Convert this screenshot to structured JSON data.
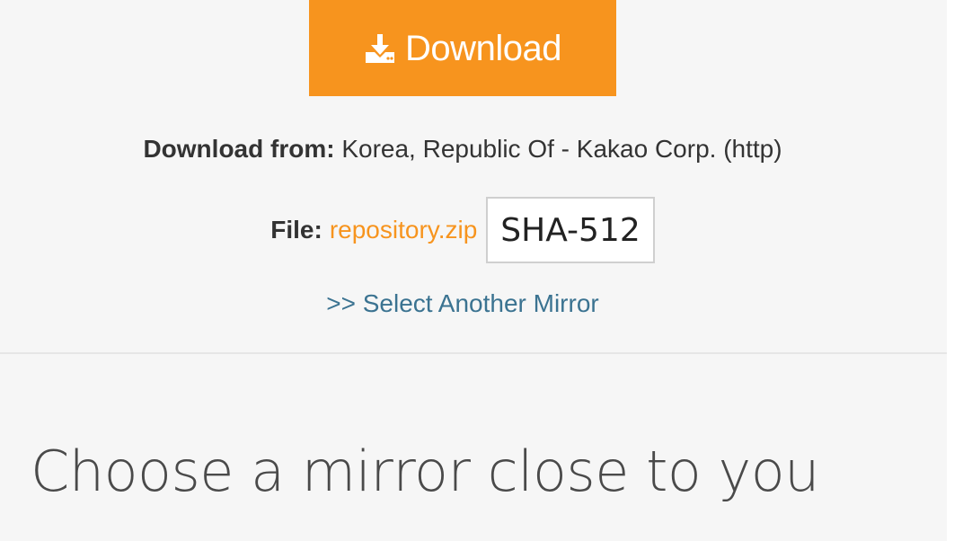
{
  "download_button": {
    "label": "Download",
    "icon": "download-icon",
    "color": "#f7941e"
  },
  "download_from": {
    "label": "Download from:",
    "value": "Korea, Republic Of - Kakao Corp. (http)"
  },
  "file": {
    "label": "File:",
    "name": "repository.zip",
    "hash_button": "SHA-512"
  },
  "mirror_link": ">> Select Another Mirror",
  "section_title": "Choose a mirror close to you",
  "colors": {
    "accent": "#f7941e",
    "link": "#3b7391",
    "panel_bg": "#f6f6f6"
  }
}
